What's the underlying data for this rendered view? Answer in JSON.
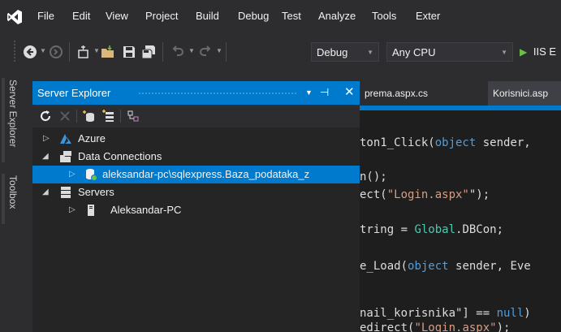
{
  "menu": [
    "File",
    "Edit",
    "View",
    "Project",
    "Build",
    "Debug",
    "Test",
    "Analyze",
    "Tools",
    "Exter"
  ],
  "toolbar": {
    "config": "Debug",
    "platform": "Any CPU",
    "run_label": "IIS E"
  },
  "side_tabs": [
    "Server Explorer",
    "Toolbox"
  ],
  "explorer": {
    "title": "Server Explorer",
    "nodes": [
      {
        "label": "Azure"
      },
      {
        "label": "Data Connections"
      },
      {
        "label": "aleksandar-pc\\sqlexpress.Baza_podataka_z"
      },
      {
        "label": "Servers"
      },
      {
        "label": "Aleksandar-PC"
      }
    ]
  },
  "editor": {
    "tabs": [
      "prema.aspx.cs",
      "Korisnici.asp"
    ],
    "lines": [
      {
        "parts": [
          [
            "",
            "ton1_Click("
          ],
          [
            "kw",
            "object"
          ],
          [
            "",
            " sender,"
          ]
        ]
      },
      {
        "parts": [
          [
            "",
            "n();"
          ]
        ]
      },
      {
        "parts": [
          [
            "",
            "ect("
          ],
          [
            "str",
            "\"Login.aspx\""
          ],
          [
            "",
            "\");"
          ]
        ]
      },
      {
        "parts": [
          [
            "",
            "tring = "
          ],
          [
            "ty",
            "Global"
          ],
          [
            "",
            ".DBCon;"
          ]
        ]
      },
      {
        "parts": [
          [
            "",
            "e_Load("
          ],
          [
            "kw",
            "object"
          ],
          [
            "",
            " sender, Eve"
          ]
        ]
      },
      {
        "parts": [
          [
            "",
            "nail_korisnika\"] == "
          ],
          [
            "kw",
            "null"
          ],
          [
            "",
            ")"
          ]
        ]
      },
      {
        "parts": [
          [
            "",
            "edirect("
          ],
          [
            "str",
            "\"Login.aspx\""
          ],
          [
            "",
            ");"
          ]
        ]
      }
    ]
  },
  "colors": {
    "accent": "#007acc",
    "bg": "#2d2d30",
    "panel": "#252526",
    "editor": "#1e1e1e"
  }
}
